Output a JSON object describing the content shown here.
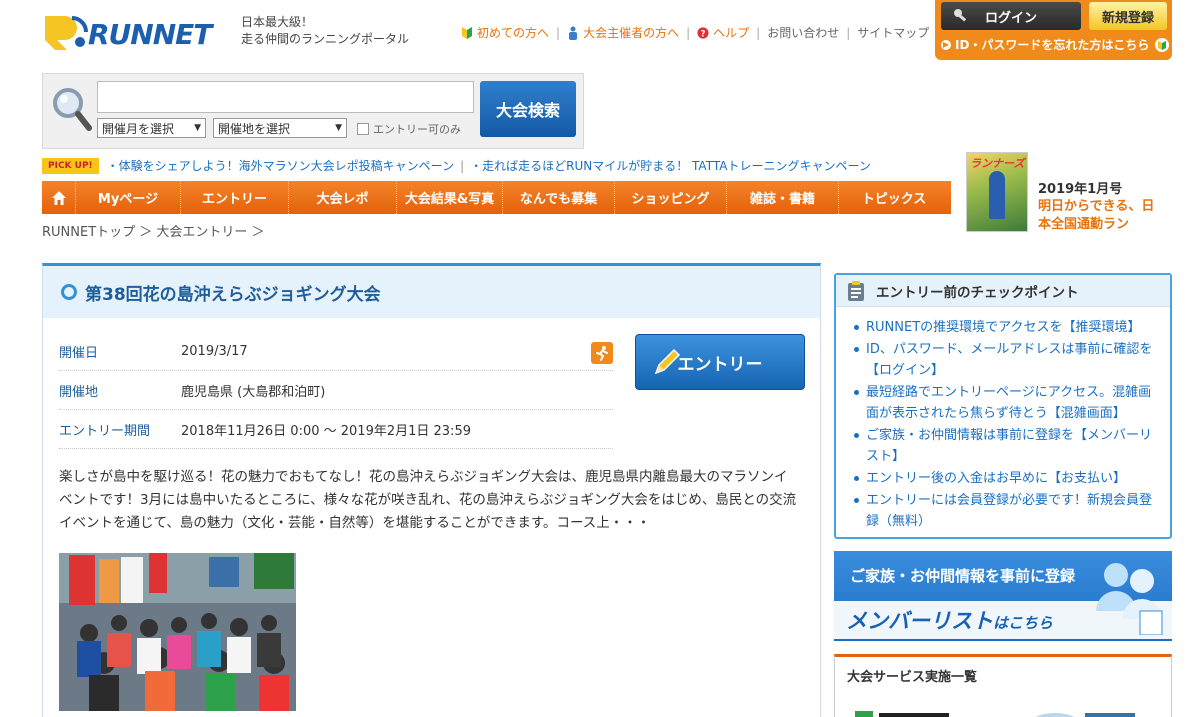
{
  "header": {
    "logo_text": "RUNNET",
    "tagline_line1": "日本最大級！",
    "tagline_line2": "走る仲間のランニングポータル",
    "links": {
      "beginners": "初めての方へ",
      "organizers": "大会主催者の方へ",
      "help": "ヘルプ",
      "contact": "お問い合わせ",
      "sitemap": "サイトマップ"
    },
    "login": "ログイン",
    "register": "新規登録",
    "forgot": "ID・パスワードを忘れた方はこちら"
  },
  "search": {
    "query": "",
    "month_select": "開催月を選択",
    "area_select": "開催地を選択",
    "entry_only": "エントリー可のみ",
    "button": "大会検索"
  },
  "pickup": {
    "badge": "PICK UP!",
    "item1": "・体験をシェアしよう！海外マラソン大会レポ投稿キャンペーン",
    "item2": "・走れば走るほどRUNマイルが貯まる！ TATTAトレーニングキャンペーン"
  },
  "magazine": {
    "cover_title": "ランナーズ",
    "date": "2019年1月号",
    "title": "明日からできる、日本全国通勤ラン"
  },
  "mainnav": {
    "items": [
      "Myページ",
      "エントリー",
      "大会レポ",
      "大会結果&写真",
      "なんでも募集",
      "ショッピング",
      "雑誌・書籍",
      "トピックス"
    ]
  },
  "breadcrumb": "RUNNETトップ ＞ 大会エントリー ＞",
  "event": {
    "title": "第38回花の島沖えらぶジョギング大会",
    "rows": [
      {
        "key": "開催日",
        "value": "2019/3/17"
      },
      {
        "key": "開催地",
        "value": "鹿児島県 (大島郡和泊町)"
      },
      {
        "key": "エントリー期間",
        "value": "2018年11月26日 0:00 〜 2019年2月1日 23:59"
      }
    ],
    "entry_button": "エントリー",
    "description": "楽しさが島中を駆け巡る！花の魅力でおもてなし！花の島沖えらぶジョギング大会は、鹿児島県内離島最大のマラソンイベントです！3月には島中いたるところに、様々な花が咲き乱れ、花の島沖えらぶジョギング大会をはじめ、島民との交流イベントを通じて、島の魅力（文化・芸能・自然等）を堪能することができます。コース上・・・"
  },
  "sidebar": {
    "check_title": "エントリー前のチェックポイント",
    "check_items": [
      "RUNNETの推奨環境でアクセスを【推奨環境】",
      "ID、パスワード、メールアドレスは事前に確認を【ログイン】",
      "最短経路でエントリーページにアクセス。混雑画面が表示されたら焦らず待とう【混雑画面】",
      "ご家族・お仲間情報は事前に登録を【メンバーリスト】",
      "エントリー後の入金はお早めに【お支払い】",
      "エントリーには会員登録が必要です！新規会員登録（無料）"
    ],
    "banner_line1": "ご家族・お仲間情報を事前に登録",
    "banner_line2": "メンバーリスト",
    "banner_line2_suffix": "はこちら",
    "service_title": "大会サービス実施一覧"
  },
  "colors": {
    "brand_blue": "#1b5fae",
    "nav_orange": "#e4620a",
    "link_blue": "#1b6fc2",
    "accent_yellow": "#f5c623"
  }
}
